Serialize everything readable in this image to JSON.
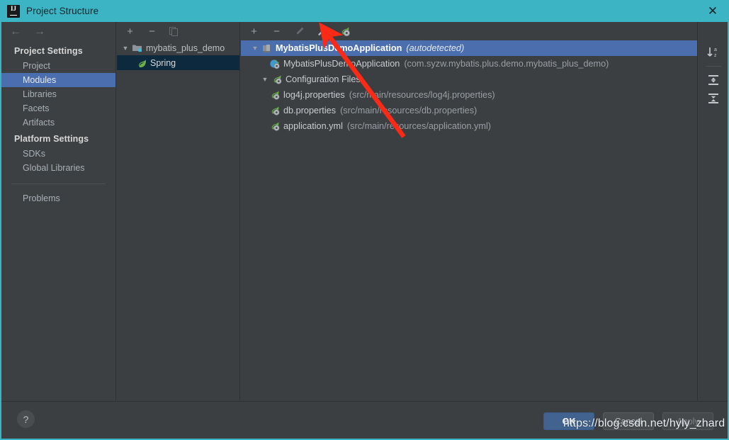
{
  "window": {
    "title": "Project Structure",
    "app_icon": "intellij-idea-icon",
    "close_label": "✕",
    "titlebar_color": "#3cb4c4"
  },
  "nav": {
    "back_icon": "←",
    "forward_icon": "→"
  },
  "sidebar": {
    "groups": [
      {
        "title": "Project Settings",
        "items": [
          {
            "label": "Project",
            "selected": false
          },
          {
            "label": "Modules",
            "selected": true
          },
          {
            "label": "Libraries",
            "selected": false
          },
          {
            "label": "Facets",
            "selected": false
          },
          {
            "label": "Artifacts",
            "selected": false
          }
        ]
      },
      {
        "title": "Platform Settings",
        "items": [
          {
            "label": "SDKs",
            "selected": false
          },
          {
            "label": "Global Libraries",
            "selected": false
          }
        ]
      }
    ],
    "extra": [
      {
        "label": "Problems",
        "selected": false
      }
    ],
    "selected_color": "#4b6eaf"
  },
  "modules_panel": {
    "toolbar": [
      {
        "name": "add-module-button",
        "glyph": "+",
        "enabled": true
      },
      {
        "name": "remove-module-button",
        "glyph": "−",
        "enabled": true
      },
      {
        "name": "copy-module-button",
        "glyph": "⧉",
        "enabled": false
      }
    ],
    "tree": [
      {
        "label": "mybatis_plus_demo",
        "icon": "module-folder-icon",
        "expanded": true,
        "selected": false,
        "children": [
          {
            "label": "Spring",
            "icon": "spring-leaf-icon",
            "selected": true
          }
        ]
      }
    ]
  },
  "detail_panel": {
    "toolbar": [
      {
        "name": "add-facet-button",
        "glyph": "+",
        "enabled": true
      },
      {
        "name": "remove-facet-button",
        "glyph": "−",
        "enabled": true
      },
      {
        "name": "edit-facet-button",
        "glyph": "pencil-icon",
        "enabled": false
      },
      {
        "name": "configure-facet-button",
        "glyph": "wrench-icon",
        "enabled": true
      },
      {
        "name": "spring-context-button",
        "glyph": "spring-bean-icon",
        "enabled": true
      }
    ],
    "rows": [
      {
        "name": "spring-context-root",
        "label": "MybatisPlusDemoApplication",
        "meta": "(autodetected)",
        "icon": "spring-context-icon",
        "indent": 0,
        "twisty": "▼",
        "selected": true
      },
      {
        "name": "spring-config-class",
        "label": "MybatisPlusDemoApplication",
        "meta": "(com.syzw.mybatis.plus.demo.mybatis_plus_demo)",
        "icon": "spring-java-config-icon",
        "indent": 1,
        "twisty": "",
        "selected": false
      },
      {
        "name": "configuration-files-group",
        "label": "Configuration Files",
        "meta": "",
        "icon": "spring-bean-icon",
        "indent": 1,
        "twisty": "▼",
        "selected": false
      },
      {
        "name": "config-file-log4j",
        "label": "log4j.properties",
        "meta": "(src/main/resources/log4j.properties)",
        "icon": "spring-bean-icon",
        "indent": 2,
        "twisty": "",
        "selected": false
      },
      {
        "name": "config-file-db",
        "label": "db.properties",
        "meta": "(src/main/resources/db.properties)",
        "icon": "spring-bean-icon",
        "indent": 2,
        "twisty": "",
        "selected": false
      },
      {
        "name": "config-file-application",
        "label": "application.yml",
        "meta": "(src/main/resources/application.yml)",
        "icon": "spring-bean-icon",
        "indent": 2,
        "twisty": "",
        "selected": false
      }
    ]
  },
  "side_tools": [
    {
      "name": "sort-alphabetically-button",
      "icon": "sort-az-icon"
    },
    {
      "name": "expand-all-button",
      "icon": "expand-all-icon"
    },
    {
      "name": "collapse-all-button",
      "icon": "collapse-all-icon"
    }
  ],
  "footer": {
    "help_label": "?",
    "ok_label": "OK",
    "cancel_label": "Cancel",
    "apply_label": "Apply"
  },
  "annotation": {
    "arrow_color": "#fa2a17",
    "watermark": "https://blog.csdn.net/hyly_zhard"
  }
}
